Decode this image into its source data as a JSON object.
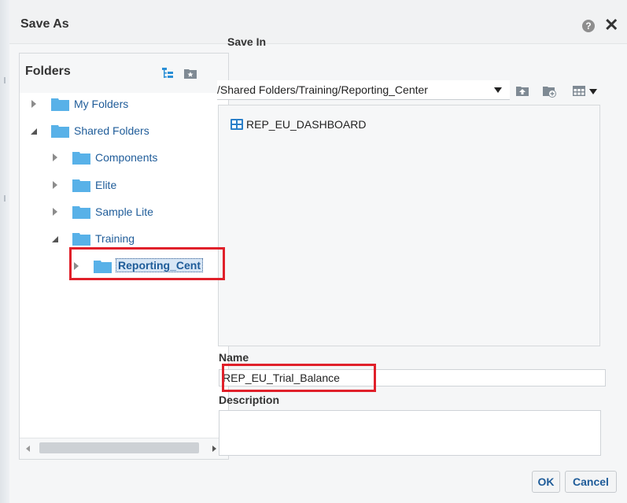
{
  "dialog": {
    "title": "Save As"
  },
  "folders": {
    "title": "Folders",
    "tree": [
      {
        "label": "My Folders",
        "state": "collapsed"
      },
      {
        "label": "Shared Folders",
        "state": "expanded"
      },
      {
        "label": "Components",
        "state": "collapsed"
      },
      {
        "label": "Elite",
        "state": "collapsed"
      },
      {
        "label": "Sample Lite",
        "state": "collapsed"
      },
      {
        "label": "Training",
        "state": "expanded"
      },
      {
        "label": "Reporting_Cent",
        "state": "collapsed",
        "selected": true
      }
    ]
  },
  "save_in": {
    "label": "Save In",
    "path": "/Shared Folders/Training/Reporting_Center"
  },
  "files": [
    {
      "name": "REP_EU_DASHBOARD",
      "icon": "dashboard-icon"
    }
  ],
  "name_field": {
    "label": "Name",
    "value": "REP_EU_Trial_Balance"
  },
  "description_field": {
    "label": "Description",
    "value": ""
  },
  "buttons": {
    "ok": "OK",
    "cancel": "Cancel"
  },
  "colors": {
    "link": "#1f5c99",
    "folder": "#58b1e8",
    "highlight": "#e0202a",
    "selection": "#d8e6f5"
  }
}
